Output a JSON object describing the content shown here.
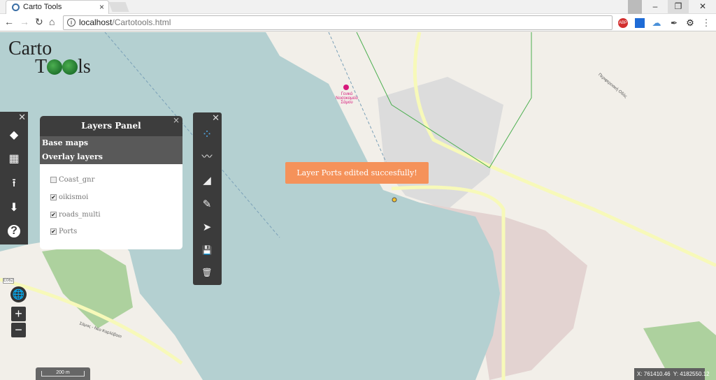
{
  "browser": {
    "tab_title": "Carto Tools",
    "tab_close": "×",
    "url_host": "localhost",
    "url_path": "/Cartotools.html",
    "info_icon": "i",
    "window_controls": {
      "minimize": "–",
      "restore": "❐",
      "close": "✕"
    },
    "extensions": [
      {
        "name": "adblock-icon",
        "label": "ABP",
        "color": "#d32f2f"
      },
      {
        "name": "extension-window-icon",
        "label": "",
        "color": "#1e6bd6"
      },
      {
        "name": "cloud-icon",
        "label": "",
        "color": "#4a90d9"
      },
      {
        "name": "eyedropper-icon",
        "label": "",
        "color": "#444"
      }
    ]
  },
  "logo": {
    "line1": "Carto",
    "line2_start": "T",
    "line2_end": "ls"
  },
  "sidebar": {
    "close": "✕",
    "buttons": [
      {
        "name": "layers-icon",
        "glyph": "◆"
      },
      {
        "name": "grid-icon",
        "glyph": "▦"
      },
      {
        "name": "upload-icon",
        "glyph": "⭱"
      },
      {
        "name": "download-icon",
        "glyph": "⬇"
      },
      {
        "name": "help-icon",
        "glyph": "?"
      }
    ]
  },
  "layers_panel": {
    "title": "Layers Panel",
    "close": "×",
    "base_maps": "Base maps",
    "overlay_layers": "Overlay layers",
    "layers": [
      {
        "name": "Coast_gnr",
        "checked": false
      },
      {
        "name": "oikismoi",
        "checked": true
      },
      {
        "name": "roads_multi",
        "checked": true
      },
      {
        "name": "Ports",
        "checked": true
      }
    ]
  },
  "draw_toolbar": {
    "close": "✕",
    "tools": [
      {
        "name": "point-tool-icon",
        "glyph": "⁘"
      },
      {
        "name": "line-tool-icon",
        "glyph": "〰"
      },
      {
        "name": "polygon-tool-icon",
        "glyph": "◢"
      },
      {
        "name": "edit-tool-icon",
        "glyph": "✎"
      },
      {
        "name": "select-tool-icon",
        "glyph": "➤"
      },
      {
        "name": "save-icon",
        "glyph": "💾"
      },
      {
        "name": "delete-icon",
        "glyph": "🗑"
      }
    ]
  },
  "toast": {
    "message": "Layer Ports edited succesfully!",
    "color": "#f5925a"
  },
  "map_controls": {
    "zoom_in": "+",
    "zoom_out": "−",
    "globe": "🌐"
  },
  "scale": {
    "label": "200 m"
  },
  "coordinates": {
    "x": "X: 761410.46",
    "y": "Y: 4182550.12"
  },
  "map_labels": {
    "road_code": "E062",
    "road1": "Σάμος - Νέο Καρλόβασι",
    "road2": "Περιφερειακή Οδός",
    "hospital": "Γενικό Νοσοκομείο Σάμου"
  },
  "colors": {
    "sea": "#b4d0d1",
    "land": "#f2efe9",
    "urban": "#e3d3d1",
    "park": "#add19e",
    "road": "#f7f9b9"
  }
}
